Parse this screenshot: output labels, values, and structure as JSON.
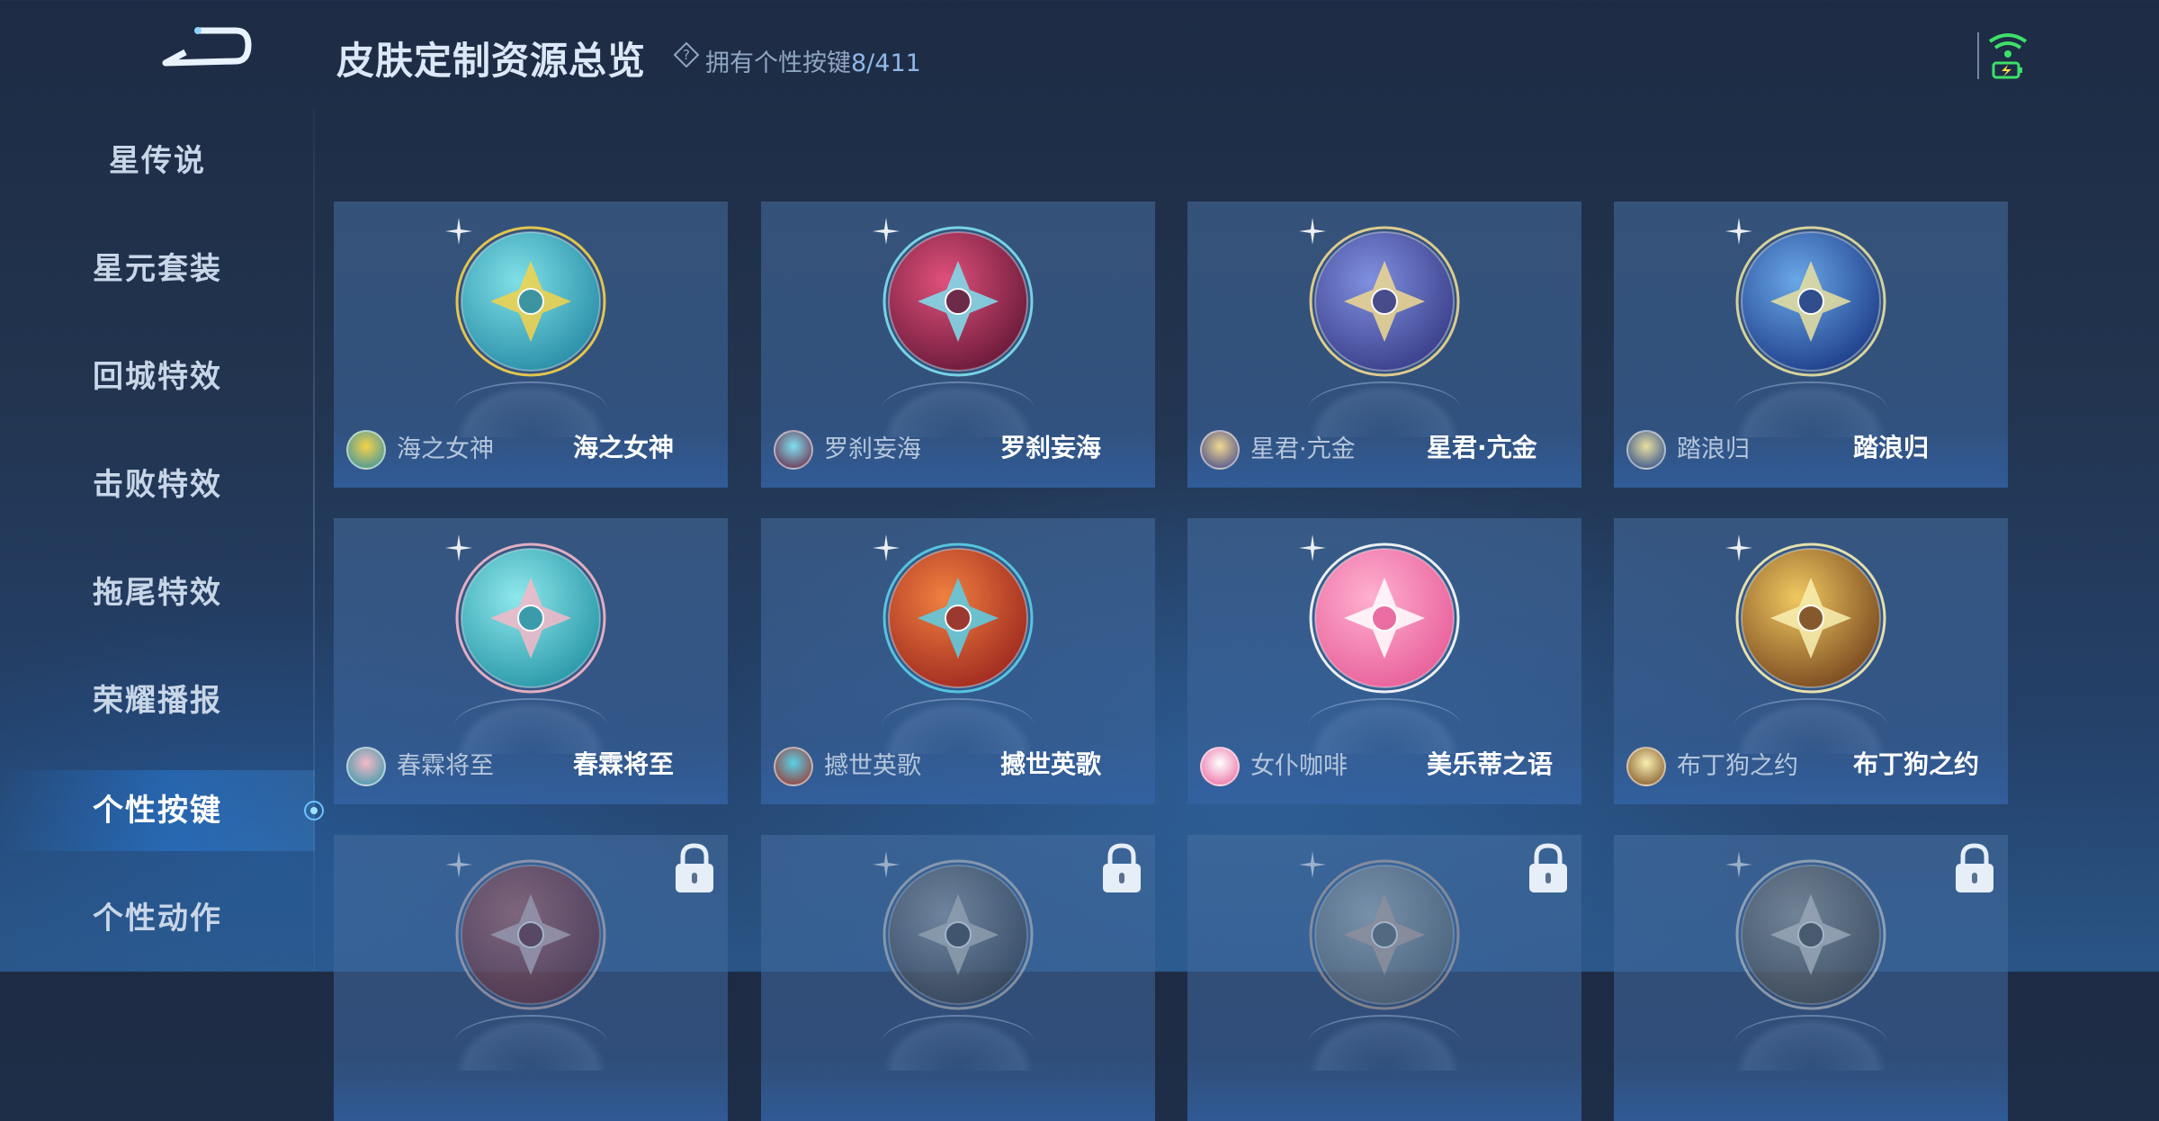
{
  "header": {
    "title": "皮肤定制资源总览",
    "owned_label": "拥有个性按键",
    "owned_count": "8/411"
  },
  "sidebar": {
    "items": [
      {
        "label": "星传说",
        "active": false
      },
      {
        "label": "星元套装",
        "active": false
      },
      {
        "label": "回城特效",
        "active": false
      },
      {
        "label": "击败特效",
        "active": false
      },
      {
        "label": "拖尾特效",
        "active": false
      },
      {
        "label": "荣耀播报",
        "active": false
      },
      {
        "label": "个性按键",
        "active": true
      },
      {
        "label": "个性动作",
        "active": false
      }
    ]
  },
  "cards": [
    {
      "hero": "海之女神",
      "skin": "海之女神",
      "locked": false,
      "icon": "golden-flower-icon",
      "colors": [
        "#7fe0e6",
        "#2a8ea8",
        "#f5d24a"
      ]
    },
    {
      "hero": "罗刹妄海",
      "skin": "罗刹妄海",
      "locked": false,
      "icon": "crimson-blade-icon",
      "colors": [
        "#e0507a",
        "#6a1a3a",
        "#7fe0f0"
      ]
    },
    {
      "hero": "星君·亢金",
      "skin": "星君·亢金",
      "locked": false,
      "icon": "celestial-horse-icon",
      "colors": [
        "#8090e0",
        "#3a3f8a",
        "#f0d890"
      ]
    },
    {
      "hero": "踏浪归",
      "skin": "踏浪归",
      "locked": false,
      "icon": "trident-icon",
      "colors": [
        "#6aa8e8",
        "#1f3f8a",
        "#e8e0a0"
      ]
    },
    {
      "hero": "春霖将至",
      "skin": "春霖将至",
      "locked": false,
      "icon": "jade-cloud-icon",
      "colors": [
        "#8ee8ec",
        "#2a98a8",
        "#f5b8c8"
      ]
    },
    {
      "hero": "撼世英歌",
      "skin": "撼世英歌",
      "locked": false,
      "icon": "fire-drum-icon",
      "colors": [
        "#f08040",
        "#a02a20",
        "#5ad0e8"
      ]
    },
    {
      "hero": "女仆咖啡",
      "skin": "美乐蒂之语",
      "locked": false,
      "icon": "my-melody-icon",
      "colors": [
        "#ffb0d0",
        "#e8609a",
        "#ffffff"
      ]
    },
    {
      "hero": "布丁狗之约",
      "skin": "布丁狗之约",
      "locked": false,
      "icon": "golden-ribbon-icon",
      "colors": [
        "#f0c860",
        "#7a4a20",
        "#f8f0b0"
      ]
    },
    {
      "hero": "",
      "skin": "",
      "locked": true,
      "icon": "red-rune-icon",
      "colors": [
        "#e06060",
        "#8a2030",
        "#f0c0c0"
      ]
    },
    {
      "hero": "",
      "skin": "",
      "locked": true,
      "icon": "dark-warrior-icon",
      "colors": [
        "#9aa0a8",
        "#3a4048",
        "#d8d0c0"
      ]
    },
    {
      "hero": "",
      "skin": "",
      "locked": true,
      "icon": "bronze-clock-icon",
      "colors": [
        "#a8b8c0",
        "#5a6a72",
        "#e0b090"
      ]
    },
    {
      "hero": "",
      "skin": "",
      "locked": true,
      "icon": "bone-blade-icon",
      "colors": [
        "#a0a098",
        "#4a4a44",
        "#e8e0d0"
      ]
    }
  ]
}
